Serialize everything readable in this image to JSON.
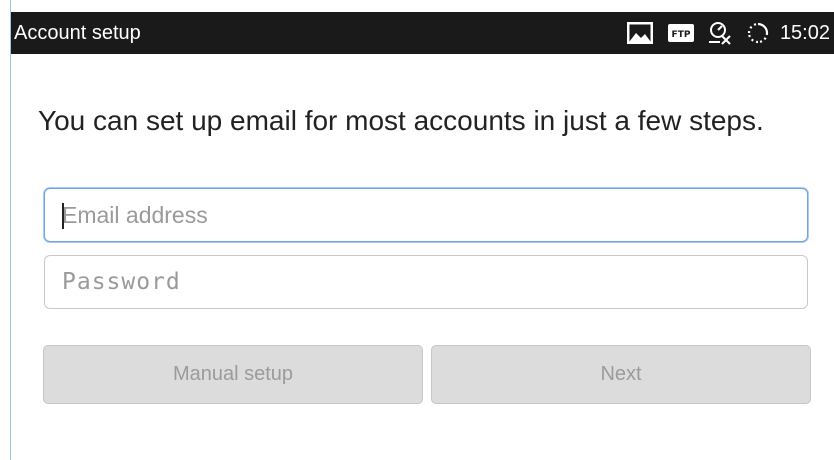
{
  "status_bar": {
    "title": "Account setup",
    "time": "15:02",
    "icons": [
      "image-icon",
      "ftp-icon",
      "sync-off-icon",
      "loading-icon"
    ],
    "ftp_label": "FTP"
  },
  "form": {
    "intro": "You can set up email for most accounts in just a few steps.",
    "email": {
      "value": "",
      "placeholder": "Email address"
    },
    "password": {
      "value": "",
      "placeholder": "Password"
    }
  },
  "buttons": {
    "manual_setup": "Manual setup",
    "next": "Next"
  },
  "colors": {
    "status_bar_bg": "#1a1a1a",
    "focus_border": "#6ea6df",
    "button_bg": "#dcdcdc",
    "button_text_disabled": "#9b9b9b"
  }
}
